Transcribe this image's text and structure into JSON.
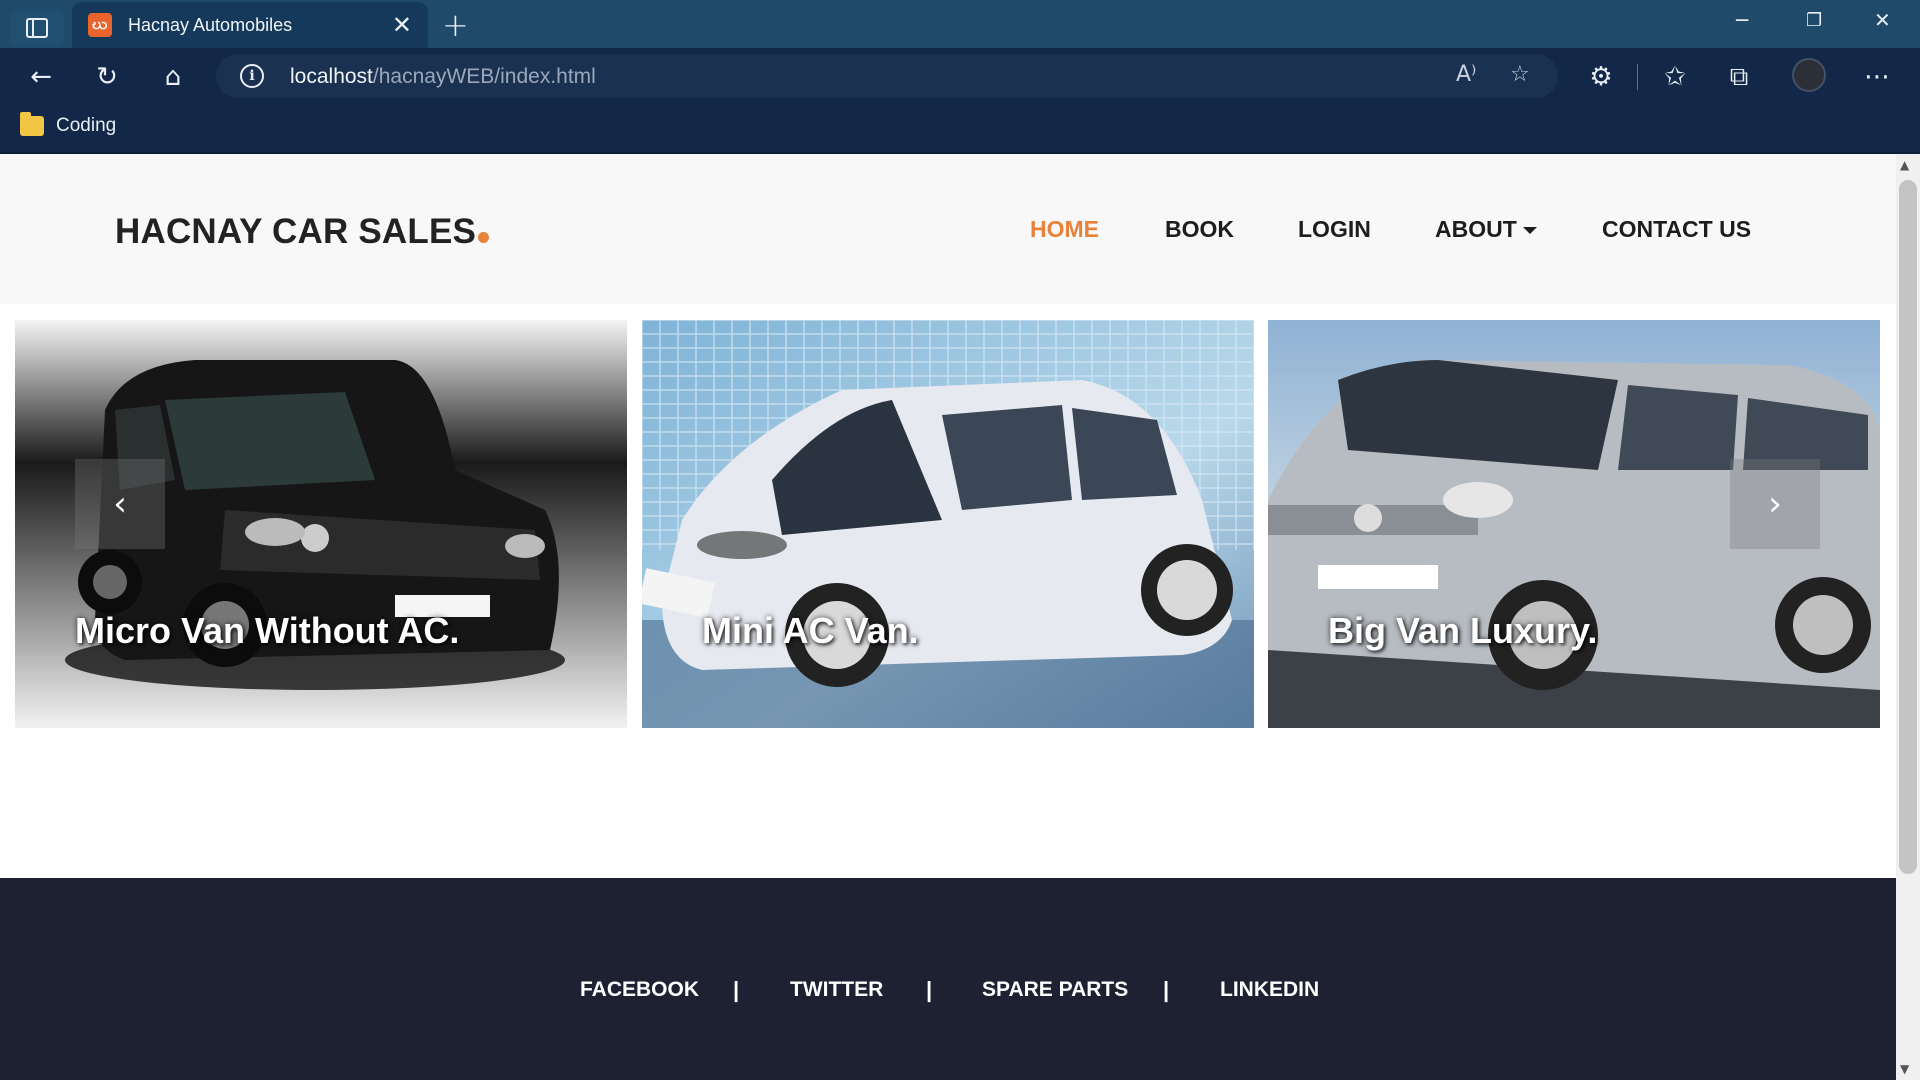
{
  "browser": {
    "tab_title": "Hacnay Automobiles",
    "tab_close": "✕",
    "new_tab": "+",
    "url_host": "localhost",
    "url_path": "/hacnayWEB/index.html",
    "bookmark_folder": "Coding",
    "icons": [
      "sidebar-icon",
      "back-icon",
      "reload-icon",
      "home-icon",
      "info-icon",
      "read-aloud-icon",
      "favorite-add-icon",
      "extensions-icon",
      "favorites-icon",
      "collections-icon",
      "profile-avatar",
      "more-icon",
      "minimize-icon",
      "restore-icon",
      "close-window-icon"
    ]
  },
  "site": {
    "brand": "HACNAY CAR SALES",
    "accent_color": "#e8823a",
    "nav": {
      "home": "HOME",
      "book": "BOOK",
      "login": "LOGIN",
      "about": "ABOUT",
      "contact": "CONTACT US"
    },
    "carousel": {
      "slides": [
        {
          "caption": "Micro Van Without AC."
        },
        {
          "caption": "Mini AC Van."
        },
        {
          "caption": "Big Van Luxury."
        }
      ],
      "prev": "‹",
      "next": "›"
    },
    "footer": {
      "links": [
        "FACEBOOK",
        "TWITTER",
        "SPARE PARTS",
        "LINKEDIN"
      ],
      "separator": "|",
      "background": "#1d2132"
    }
  }
}
